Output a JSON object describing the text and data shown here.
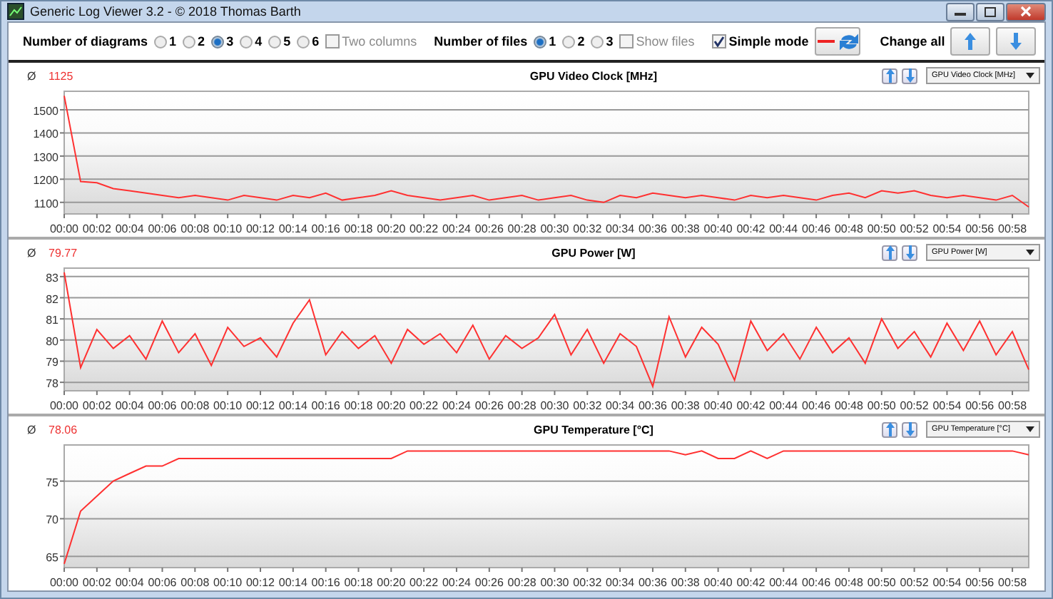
{
  "window": {
    "title": "Generic Log Viewer 3.2 - © 2018 Thomas Barth"
  },
  "toolbar": {
    "diagrams_label": "Number of diagrams",
    "diagram_options": [
      {
        "label": "1",
        "selected": false
      },
      {
        "label": "2",
        "selected": false
      },
      {
        "label": "3",
        "selected": true
      },
      {
        "label": "4",
        "selected": false
      },
      {
        "label": "5",
        "selected": false
      },
      {
        "label": "6",
        "selected": false
      }
    ],
    "two_columns": {
      "label": "Two columns",
      "checked": false,
      "disabled": true
    },
    "files_label": "Number of files",
    "file_options": [
      {
        "label": "1",
        "selected": true
      },
      {
        "label": "2",
        "selected": false
      },
      {
        "label": "3",
        "selected": false
      }
    ],
    "show_files": {
      "label": "Show files",
      "checked": false,
      "disabled": true
    },
    "simple_mode": {
      "label": "Simple mode",
      "checked": true,
      "disabled": false
    },
    "change_all_label": "Change all"
  },
  "diagrams": [
    {
      "avg_symbol": "Ø",
      "average": "1125",
      "selector": "GPU Video Clock [MHz]",
      "chart_data": {
        "type": "line",
        "title": "GPU Video Clock [MHz]",
        "grid": true,
        "ylim": [
          1050,
          1580
        ],
        "xlim": [
          0,
          59
        ],
        "yticks": [
          1100,
          1200,
          1300,
          1400,
          1500
        ],
        "xticks": [
          {
            "value": 0,
            "label": "00:00"
          },
          {
            "value": 2,
            "label": "00:02"
          },
          {
            "value": 4,
            "label": "00:04"
          },
          {
            "value": 6,
            "label": "00:06"
          },
          {
            "value": 8,
            "label": "00:08"
          },
          {
            "value": 10,
            "label": "00:10"
          },
          {
            "value": 12,
            "label": "00:12"
          },
          {
            "value": 14,
            "label": "00:14"
          },
          {
            "value": 16,
            "label": "00:16"
          },
          {
            "value": 18,
            "label": "00:18"
          },
          {
            "value": 20,
            "label": "00:20"
          },
          {
            "value": 22,
            "label": "00:22"
          },
          {
            "value": 24,
            "label": "00:24"
          },
          {
            "value": 26,
            "label": "00:26"
          },
          {
            "value": 28,
            "label": "00:28"
          },
          {
            "value": 30,
            "label": "00:30"
          },
          {
            "value": 32,
            "label": "00:32"
          },
          {
            "value": 34,
            "label": "00:34"
          },
          {
            "value": 36,
            "label": "00:36"
          },
          {
            "value": 38,
            "label": "00:38"
          },
          {
            "value": 40,
            "label": "00:40"
          },
          {
            "value": 42,
            "label": "00:42"
          },
          {
            "value": 44,
            "label": "00:44"
          },
          {
            "value": 46,
            "label": "00:46"
          },
          {
            "value": 48,
            "label": "00:48"
          },
          {
            "value": 50,
            "label": "00:50"
          },
          {
            "value": 52,
            "label": "00:52"
          },
          {
            "value": 54,
            "label": "00:54"
          },
          {
            "value": 56,
            "label": "00:56"
          },
          {
            "value": 58,
            "label": "00:58"
          }
        ],
        "x": [
          0,
          1,
          2,
          3,
          4,
          5,
          6,
          7,
          8,
          9,
          10,
          11,
          12,
          13,
          14,
          15,
          16,
          17,
          18,
          19,
          20,
          21,
          22,
          23,
          24,
          25,
          26,
          27,
          28,
          29,
          30,
          31,
          32,
          33,
          34,
          35,
          36,
          37,
          38,
          39,
          40,
          41,
          42,
          43,
          44,
          45,
          46,
          47,
          48,
          49,
          50,
          51,
          52,
          53,
          54,
          55,
          56,
          57,
          58,
          59
        ],
        "series": [
          {
            "color": "#ff3030",
            "values": [
              1560,
              1190,
              1185,
              1160,
              1150,
              1140,
              1130,
              1120,
              1130,
              1120,
              1110,
              1130,
              1120,
              1110,
              1130,
              1120,
              1140,
              1110,
              1120,
              1130,
              1150,
              1130,
              1120,
              1110,
              1120,
              1130,
              1110,
              1120,
              1130,
              1110,
              1120,
              1130,
              1110,
              1100,
              1130,
              1120,
              1140,
              1130,
              1120,
              1130,
              1120,
              1110,
              1130,
              1120,
              1130,
              1120,
              1110,
              1130,
              1140,
              1120,
              1150,
              1140,
              1150,
              1130,
              1120,
              1130,
              1120,
              1110,
              1130,
              1080
            ]
          }
        ]
      }
    },
    {
      "avg_symbol": "Ø",
      "average": "79.77",
      "selector": "GPU Power [W]",
      "chart_data": {
        "type": "line",
        "title": "GPU Power [W]",
        "grid": true,
        "ylim": [
          77.6,
          83.4
        ],
        "xlim": [
          0,
          59
        ],
        "yticks": [
          78,
          79,
          80,
          81,
          82,
          83
        ],
        "xticks": [
          {
            "value": 0,
            "label": "00:00"
          },
          {
            "value": 2,
            "label": "00:02"
          },
          {
            "value": 4,
            "label": "00:04"
          },
          {
            "value": 6,
            "label": "00:06"
          },
          {
            "value": 8,
            "label": "00:08"
          },
          {
            "value": 10,
            "label": "00:10"
          },
          {
            "value": 12,
            "label": "00:12"
          },
          {
            "value": 14,
            "label": "00:14"
          },
          {
            "value": 16,
            "label": "00:16"
          },
          {
            "value": 18,
            "label": "00:18"
          },
          {
            "value": 20,
            "label": "00:20"
          },
          {
            "value": 22,
            "label": "00:22"
          },
          {
            "value": 24,
            "label": "00:24"
          },
          {
            "value": 26,
            "label": "00:26"
          },
          {
            "value": 28,
            "label": "00:28"
          },
          {
            "value": 30,
            "label": "00:30"
          },
          {
            "value": 32,
            "label": "00:32"
          },
          {
            "value": 34,
            "label": "00:34"
          },
          {
            "value": 36,
            "label": "00:36"
          },
          {
            "value": 38,
            "label": "00:38"
          },
          {
            "value": 40,
            "label": "00:40"
          },
          {
            "value": 42,
            "label": "00:42"
          },
          {
            "value": 44,
            "label": "00:44"
          },
          {
            "value": 46,
            "label": "00:46"
          },
          {
            "value": 48,
            "label": "00:48"
          },
          {
            "value": 50,
            "label": "00:50"
          },
          {
            "value": 52,
            "label": "00:52"
          },
          {
            "value": 54,
            "label": "00:54"
          },
          {
            "value": 56,
            "label": "00:56"
          },
          {
            "value": 58,
            "label": "00:58"
          }
        ],
        "x": [
          0,
          1,
          2,
          3,
          4,
          5,
          6,
          7,
          8,
          9,
          10,
          11,
          12,
          13,
          14,
          15,
          16,
          17,
          18,
          19,
          20,
          21,
          22,
          23,
          24,
          25,
          26,
          27,
          28,
          29,
          30,
          31,
          32,
          33,
          34,
          35,
          36,
          37,
          38,
          39,
          40,
          41,
          42,
          43,
          44,
          45,
          46,
          47,
          48,
          49,
          50,
          51,
          52,
          53,
          54,
          55,
          56,
          57,
          58,
          59
        ],
        "series": [
          {
            "color": "#ff3030",
            "values": [
              83.2,
              78.7,
              80.5,
              79.6,
              80.2,
              79.1,
              80.9,
              79.4,
              80.3,
              78.8,
              80.6,
              79.7,
              80.1,
              79.2,
              80.8,
              81.9,
              79.3,
              80.4,
              79.6,
              80.2,
              78.9,
              80.5,
              79.8,
              80.3,
              79.4,
              80.7,
              79.1,
              80.2,
              79.6,
              80.1,
              81.2,
              79.3,
              80.5,
              78.9,
              80.3,
              79.7,
              77.8,
              81.1,
              79.2,
              80.6,
              79.8,
              78.1,
              80.9,
              79.5,
              80.3,
              79.1,
              80.6,
              79.4,
              80.1,
              78.9,
              81.0,
              79.6,
              80.4,
              79.2,
              80.8,
              79.5,
              80.9,
              79.3,
              80.4,
              78.6
            ]
          }
        ]
      }
    },
    {
      "avg_symbol": "Ø",
      "average": "78.06",
      "selector": "GPU Temperature [°C]",
      "chart_data": {
        "type": "line",
        "title": "GPU Temperature [°C]",
        "grid": true,
        "ylim": [
          63.5,
          79.8
        ],
        "xlim": [
          0,
          59
        ],
        "yticks": [
          65,
          70,
          75
        ],
        "xticks": [
          {
            "value": 0,
            "label": "00:00"
          },
          {
            "value": 2,
            "label": "00:02"
          },
          {
            "value": 4,
            "label": "00:04"
          },
          {
            "value": 6,
            "label": "00:06"
          },
          {
            "value": 8,
            "label": "00:08"
          },
          {
            "value": 10,
            "label": "00:10"
          },
          {
            "value": 12,
            "label": "00:12"
          },
          {
            "value": 14,
            "label": "00:14"
          },
          {
            "value": 16,
            "label": "00:16"
          },
          {
            "value": 18,
            "label": "00:18"
          },
          {
            "value": 20,
            "label": "00:20"
          },
          {
            "value": 22,
            "label": "00:22"
          },
          {
            "value": 24,
            "label": "00:24"
          },
          {
            "value": 26,
            "label": "00:26"
          },
          {
            "value": 28,
            "label": "00:28"
          },
          {
            "value": 30,
            "label": "00:30"
          },
          {
            "value": 32,
            "label": "00:32"
          },
          {
            "value": 34,
            "label": "00:34"
          },
          {
            "value": 36,
            "label": "00:36"
          },
          {
            "value": 38,
            "label": "00:38"
          },
          {
            "value": 40,
            "label": "00:40"
          },
          {
            "value": 42,
            "label": "00:42"
          },
          {
            "value": 44,
            "label": "00:44"
          },
          {
            "value": 46,
            "label": "00:46"
          },
          {
            "value": 48,
            "label": "00:48"
          },
          {
            "value": 50,
            "label": "00:50"
          },
          {
            "value": 52,
            "label": "00:52"
          },
          {
            "value": 54,
            "label": "00:54"
          },
          {
            "value": 56,
            "label": "00:56"
          },
          {
            "value": 58,
            "label": "00:58"
          }
        ],
        "x": [
          0,
          1,
          2,
          3,
          4,
          5,
          6,
          7,
          8,
          9,
          10,
          11,
          12,
          13,
          14,
          15,
          16,
          17,
          18,
          19,
          20,
          21,
          22,
          23,
          24,
          25,
          26,
          27,
          28,
          29,
          30,
          31,
          32,
          33,
          34,
          35,
          36,
          37,
          38,
          39,
          40,
          41,
          42,
          43,
          44,
          45,
          46,
          47,
          48,
          49,
          50,
          51,
          52,
          53,
          54,
          55,
          56,
          57,
          58,
          59
        ],
        "series": [
          {
            "color": "#ff3030",
            "values": [
              64,
              71,
              73,
              75,
              76,
              77,
              77,
              78,
              78,
              78,
              78,
              78,
              78,
              78,
              78,
              78,
              78,
              78,
              78,
              78,
              78,
              79,
              79,
              79,
              79,
              79,
              79,
              79,
              79,
              79,
              79,
              79,
              79,
              79,
              79,
              79,
              79,
              79,
              78.5,
              79,
              78,
              78,
              79,
              78,
              79,
              79,
              79,
              79,
              79,
              79,
              79,
              79,
              79,
              79,
              79,
              79,
              79,
              79,
              79,
              78.5
            ]
          }
        ]
      }
    }
  ]
}
